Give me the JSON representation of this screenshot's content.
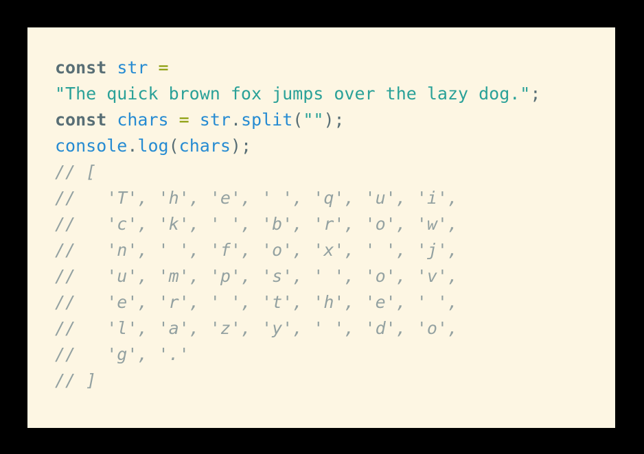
{
  "code": {
    "line1": {
      "kw": "const",
      "var": "str",
      "op": "="
    },
    "line2": {
      "str": "\"The quick brown fox jumps over the lazy dog.\"",
      "end": ";"
    },
    "line3": {
      "kw": "const",
      "var": "chars",
      "op": "=",
      "obj": "str",
      "dot": ".",
      "method": "split",
      "open": "(",
      "arg": "\"\"",
      "close": ");"
    },
    "line4": {
      "obj": "console",
      "dot": ".",
      "method": "log",
      "open": "(",
      "arg": "chars",
      "close": ");"
    },
    "comments": [
      "// [",
      "//   'T', 'h', 'e', ' ', 'q', 'u', 'i',",
      "//   'c', 'k', ' ', 'b', 'r', 'o', 'w',",
      "//   'n', ' ', 'f', 'o', 'x', ' ', 'j',",
      "//   'u', 'm', 'p', 's', ' ', 'o', 'v',",
      "//   'e', 'r', ' ', 't', 'h', 'e', ' ',",
      "//   'l', 'a', 'z', 'y', ' ', 'd', 'o',",
      "//   'g', '.'",
      "// ]"
    ]
  },
  "colors": {
    "background": "#fdf6e3",
    "keyword": "#586e75",
    "identifier": "#268bd2",
    "operator": "#859900",
    "string": "#2aa198",
    "comment": "#93a1a1"
  }
}
